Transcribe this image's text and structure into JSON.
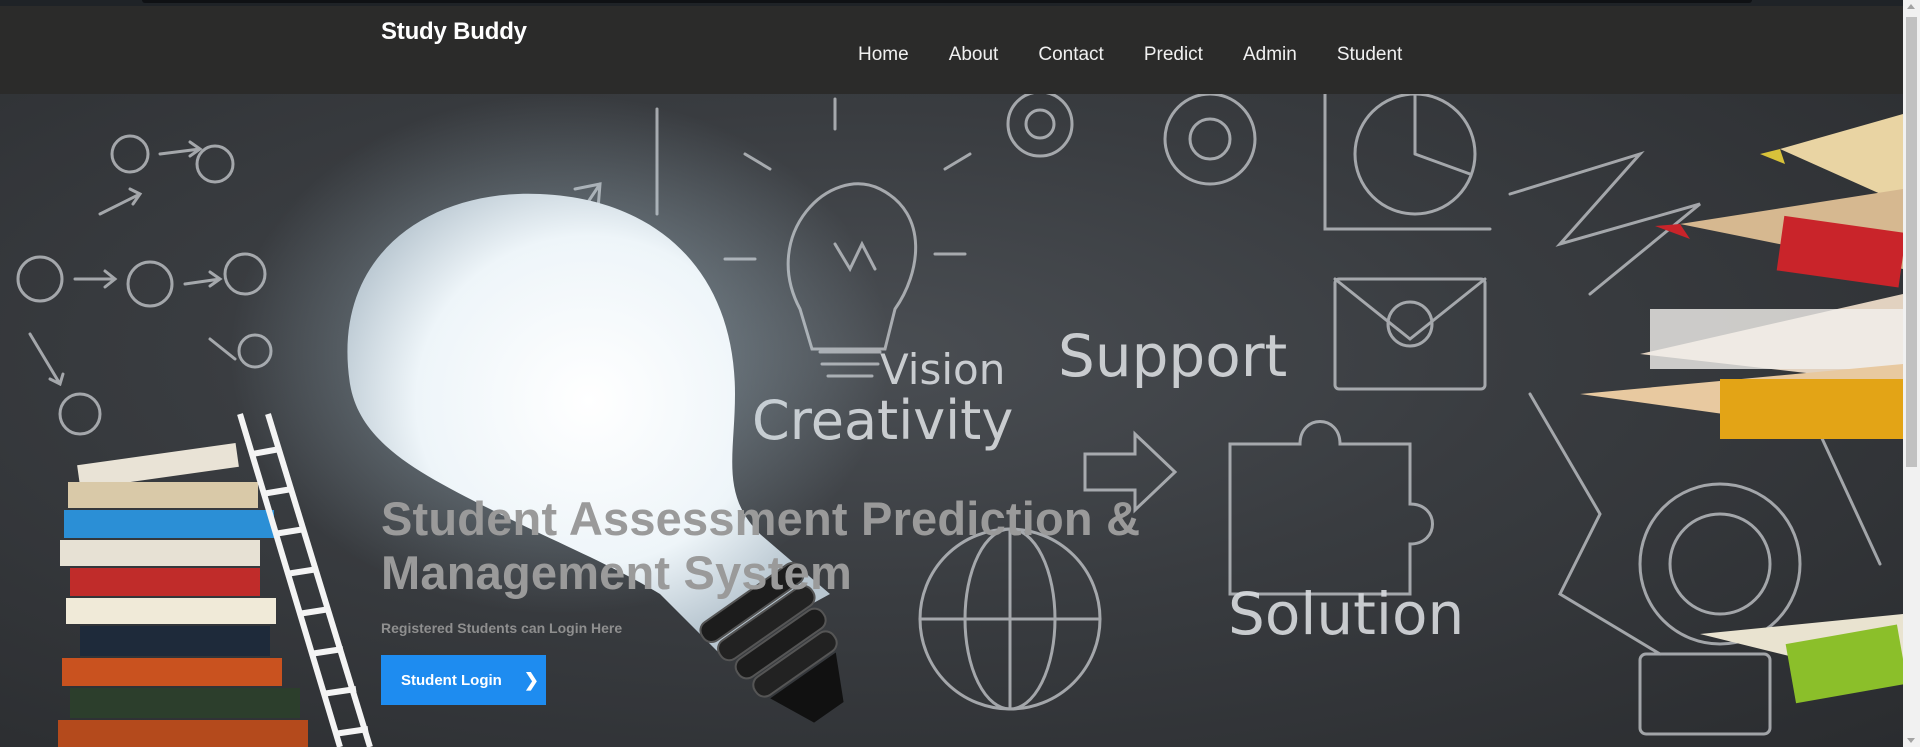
{
  "brand": {
    "name": "Study Buddy"
  },
  "nav": {
    "items": [
      "Home",
      "About",
      "Contact",
      "Predict",
      "Admin",
      "Student"
    ]
  },
  "hero": {
    "title": "Student Assessment Prediction & Management System",
    "subtitle": "Registered Students can Login Here",
    "cta_label": "Student Login",
    "cta_icon": "chevron-right-icon",
    "background_words": [
      "Vision",
      "Creativity",
      "Support",
      "Solution"
    ]
  },
  "colors": {
    "navbar": "#2b2b2a",
    "cta": "#1e8cf0",
    "hero_text": "#9a9a9a"
  }
}
